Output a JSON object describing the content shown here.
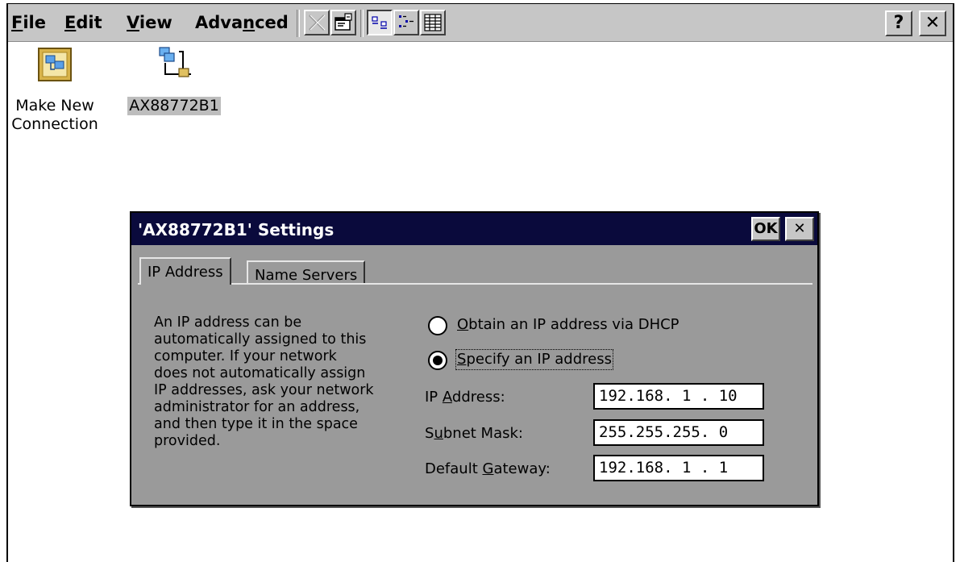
{
  "menu": {
    "file": {
      "pre": "",
      "u": "F",
      "post": "ile"
    },
    "edit": {
      "pre": "",
      "u": "E",
      "post": "dit"
    },
    "view": {
      "pre": "",
      "u": "V",
      "post": "iew"
    },
    "advanced": {
      "pre": "Adva",
      "u": "n",
      "post": "ced"
    }
  },
  "toolbar": {
    "delete_icon": "delete-x-icon",
    "properties_icon": "properties-icon",
    "large_icons_icon": "large-icons-view-icon",
    "small_icons_icon": "small-icons-view-icon",
    "details_icon": "details-view-icon"
  },
  "caption": {
    "help_label": "?",
    "close_label": "✕"
  },
  "desktop": {
    "items": [
      {
        "label_line1": "Make New",
        "label_line2": "Connection",
        "selected": false
      },
      {
        "label_line1": "AX88772B1",
        "label_line2": "",
        "selected": true
      }
    ]
  },
  "dialog": {
    "title": "'AX88772B1' Settings",
    "ok_label": "OK",
    "close_label": "✕",
    "tabs": [
      {
        "label": "IP Address",
        "active": true
      },
      {
        "label": "Name Servers",
        "active": false
      }
    ],
    "description": "An IP address can be\nautomatically assigned to this\ncomputer.  If your network\ndoes not automatically assign\nIP addresses, ask your network\nadministrator for an address,\nand then type it in the space\nprovided.",
    "options": {
      "dhcp": {
        "pre": "",
        "u": "O",
        "post": "btain an IP address via DHCP",
        "selected": false
      },
      "specify": {
        "pre": "",
        "u": "S",
        "post": "pecify an IP address",
        "selected": true
      }
    },
    "fields": {
      "ip": {
        "pre": "IP ",
        "u": "A",
        "post": "ddress:",
        "value": "192.168. 1 . 10"
      },
      "subnet": {
        "pre": "S",
        "u": "u",
        "post": "bnet Mask:",
        "value": "255.255.255. 0"
      },
      "gateway": {
        "pre": "Default ",
        "u": "G",
        "post": "ateway:",
        "value": "192.168. 1 . 1"
      }
    }
  }
}
